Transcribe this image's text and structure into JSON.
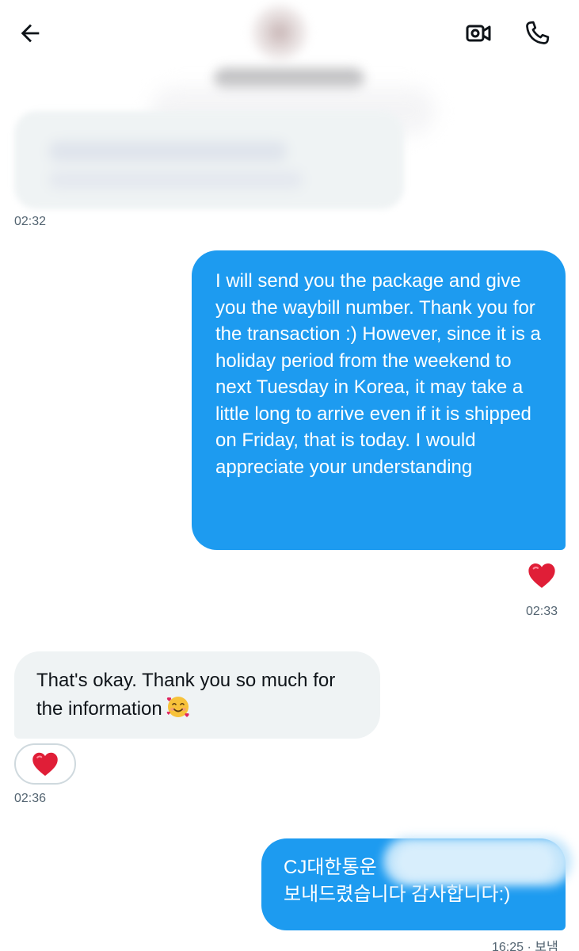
{
  "header": {
    "back_icon": "arrow-left-icon",
    "video_icon": "video-camera-icon",
    "call_icon": "phone-icon"
  },
  "messages": [
    {
      "time": "02:32"
    },
    {
      "text": "I will send you the package and give you the waybill number. Thank you for the transaction :) However, since it is a holiday period from the weekend to next Tuesday in Korea, it may take a little long to arrive even if it is shipped on Friday, that is today. I would appreciate your understanding",
      "time": "02:33",
      "reaction": "❤️"
    },
    {
      "text": "That's okay. Thank you so much for the information",
      "emoji": "🥰",
      "time": "02:36",
      "reaction": "❤️"
    },
    {
      "line1": "CJ대한통운",
      "line2": "보내드렸습니다 감사합니다:)",
      "time": "16:25 · 보냄"
    }
  ],
  "colors": {
    "outgoing_bubble": "#1d9bf0",
    "incoming_bubble": "#eff3f4",
    "heart": "#e0245e"
  }
}
